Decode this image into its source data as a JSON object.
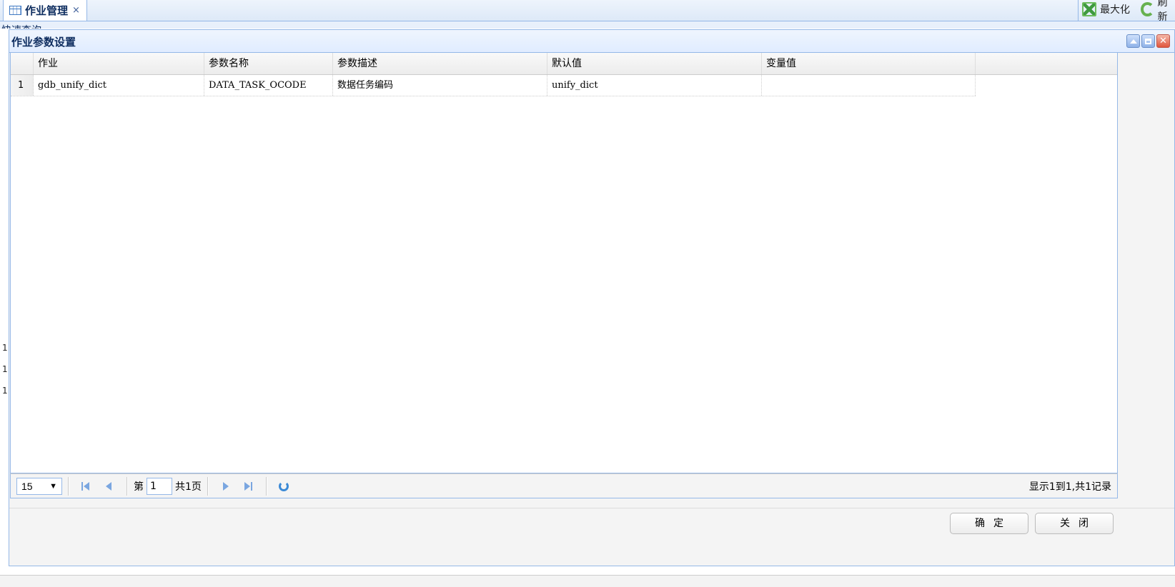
{
  "tabs": [
    {
      "label": "作业管理",
      "close": "×"
    }
  ],
  "toolbar": {
    "maximize_label": "最大化",
    "refresh_label": "刷新"
  },
  "background": {
    "partial_text": "快速查询",
    "row_numbers": [
      "1",
      "1",
      "1"
    ]
  },
  "dialog": {
    "title": "作业参数设置",
    "grid": {
      "columns": [
        "作业",
        "参数名称",
        "参数描述",
        "默认值",
        "变量值"
      ],
      "rows": [
        {
          "num": "1",
          "cells": [
            "gdb_unify_dict",
            "DATA_TASK_OCODE",
            "数据任务编码",
            "unify_dict",
            ""
          ]
        }
      ]
    },
    "pager": {
      "page_size": "15",
      "page_prefix": "第",
      "page_value": "1",
      "page_total": "共1页",
      "info": "显示1到1,共1记录"
    },
    "buttons": {
      "ok": "确定",
      "close": "关闭"
    }
  }
}
